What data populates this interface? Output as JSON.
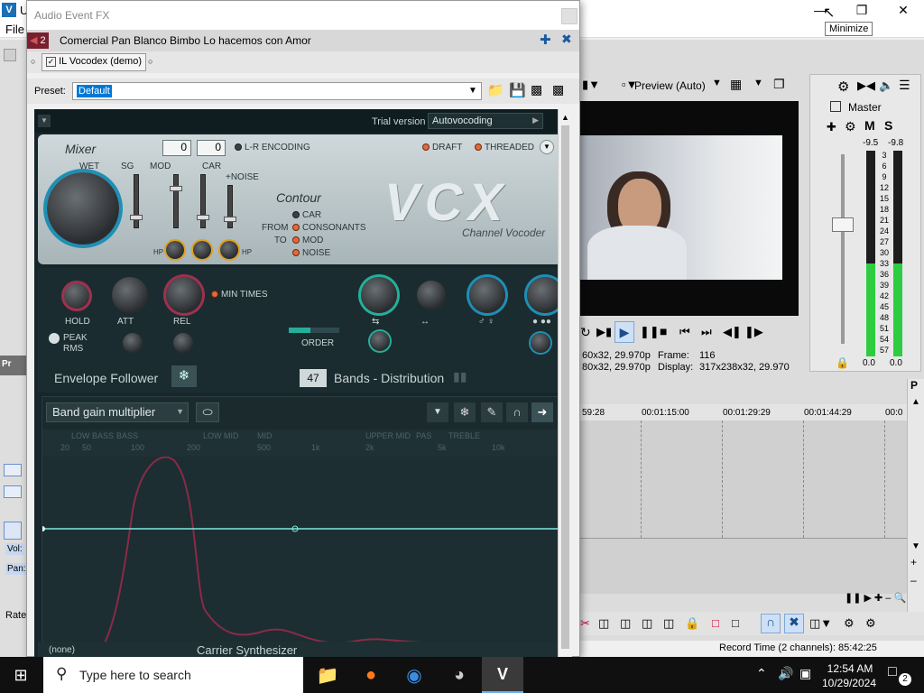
{
  "main_window": {
    "title_truncated": "U",
    "menu_file": "File",
    "min_icon": "minimize-icon",
    "restore_icon": "restore-icon",
    "close_icon": "close-icon",
    "tooltip": "Minimize"
  },
  "fx_window": {
    "title": "Audio Event FX",
    "chain_index": "2",
    "event_name": "Comercial Pan Blanco Bimbo Lo hacemos con Amor",
    "plugin_tab": "IL Vocodex (demo)",
    "preset_label": "Preset:",
    "preset_value": "Default"
  },
  "plugin": {
    "trial": "Trial version",
    "mode": "Autovocoding",
    "mixer": "Mixer",
    "num1": "0",
    "num2": "0",
    "lr_encoding": "L-R ENCODING",
    "draft": "DRAFT",
    "threaded": "THREADED",
    "wet": "WET",
    "sg": "SG",
    "mod": "MOD",
    "car": "CAR",
    "noise": "+NOISE",
    "contour": "Contour",
    "contour_car": "CAR",
    "from": "FROM",
    "consonants": "CONSONANTS",
    "to": "TO",
    "contour_mod": "MOD",
    "contour_noise": "NOISE",
    "logo": "VCX",
    "subtitle": "Channel Vocoder",
    "hp": "HP",
    "hold": "HOLD",
    "att": "ATT",
    "rel": "REL",
    "min_times": "MIN TIMES",
    "peak": "PEAK",
    "rms": "RMS",
    "order": "ORDER",
    "envelope_follower": "Envelope Follower",
    "bands_count": "47",
    "bands_label": "Bands - Distribution",
    "band_gain": "Band gain multiplier",
    "freq_regions": [
      "LOW BASS",
      "BASS",
      "LOW MID",
      "MID",
      "UPPER MID",
      "PAS",
      "TREBLE"
    ],
    "freq_ticks": [
      "20",
      "50",
      "100",
      "200",
      "500",
      "1k",
      "2k",
      "5k",
      "10k"
    ],
    "none_preset": "(none)",
    "carrier": "Carrier Synthesizer"
  },
  "preview": {
    "quality": "Preview (Auto)",
    "info_row1_a": "60x32, 29.970p",
    "frame_label": "Frame:",
    "frame_value": "116",
    "info_row2_a": "80x32, 29.970p",
    "display_label": "Display:",
    "display_value": "317x238x32, 29.970"
  },
  "master": {
    "label": "Master",
    "m": "M",
    "s": "S",
    "peak_l": "-9.5",
    "peak_r": "-9.8",
    "scale": [
      "3",
      "6",
      "9",
      "12",
      "15",
      "18",
      "21",
      "24",
      "27",
      "30",
      "33",
      "36",
      "39",
      "42",
      "45",
      "48",
      "51",
      "54",
      "57"
    ],
    "out_l": "0.0",
    "out_r": "0.0",
    "meter_level_l": 0.45,
    "meter_level_r": 0.45
  },
  "timeline": {
    "ticks": [
      "59:28",
      "00:01:15:00",
      "00:01:29:29",
      "00:01:44:29",
      "00:0"
    ]
  },
  "status": {
    "record_time": "Record Time (2 channels): 85:42:25"
  },
  "left_strip": {
    "vol": "Vol:",
    "pan": "Pan:",
    "rate": "Rate",
    "pr": "Pr"
  },
  "taskbar": {
    "search_placeholder": "Type here to search",
    "time": "12:54 AM",
    "date": "10/29/2024",
    "notif_count": "2"
  }
}
